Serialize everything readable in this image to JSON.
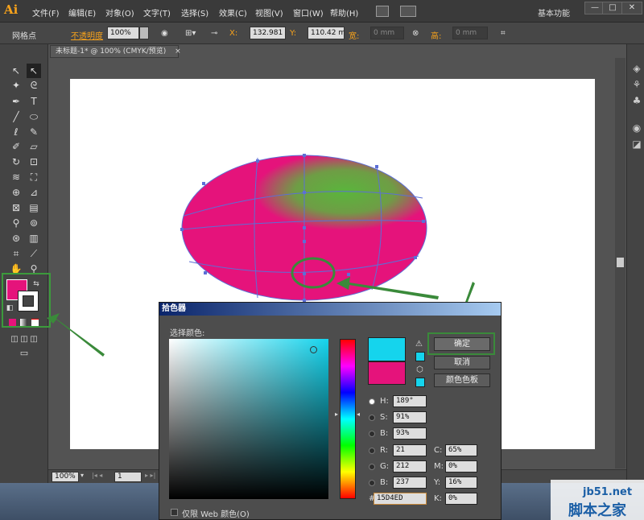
{
  "app": {
    "logo": "Ai",
    "menus": [
      "文件(F)",
      "编辑(E)",
      "对象(O)",
      "文字(T)",
      "选择(S)",
      "效果(C)",
      "视图(V)",
      "窗口(W)",
      "帮助(H)"
    ],
    "workspace": "基本功能",
    "window_controls": [
      "—",
      "□",
      "✕"
    ]
  },
  "control_bar": {
    "selection_label": "网格点",
    "opacity_label": "不透明度",
    "opacity_value": "100%",
    "x_label": "X:",
    "x_value": "132.981",
    "y_label": "Y:",
    "y_value": "110.42 mm",
    "width_label": "宽:",
    "width_value": "0 mm",
    "height_label": "高:",
    "height_value": "0 mm"
  },
  "document": {
    "tab_title": "未标题-1* @ 100% (CMYK/预览)",
    "tab_close": "×",
    "zoom_value": "100%",
    "page_value": "1"
  },
  "toolbox": {
    "fill_color": "#e5137b",
    "stroke_color": "#ffffff"
  },
  "artwork": {
    "ellipse_color": "#e5137b",
    "gradient_color": "#5ab53c"
  },
  "color_picker": {
    "title": "拾色器",
    "select_label": "选择颜色:",
    "ok_label": "确定",
    "cancel_label": "取消",
    "swatches_label": "颜色色板",
    "new_color": "#15d4ed",
    "old_color": "#e5137b",
    "fields": {
      "h_label": "H:",
      "h_value": "189°",
      "s_label": "S:",
      "s_value": "91%",
      "b_label": "B:",
      "b_value": "93%",
      "r_label": "R:",
      "r_value": "21",
      "g_label": "G:",
      "g_value": "212",
      "bl_label": "B:",
      "bl_value": "237",
      "c_label": "C:",
      "c_value": "65%",
      "m_label": "M:",
      "m_value": "0%",
      "y_label": "Y:",
      "y_value": "16%",
      "k_label": "K:",
      "k_value": "0%",
      "hex_label": "#",
      "hex_value": "15D4ED"
    },
    "web_only_label": "仅限 Web 颜色(O)"
  },
  "watermark": {
    "site": "jb51.net",
    "name": "脚本之家"
  }
}
